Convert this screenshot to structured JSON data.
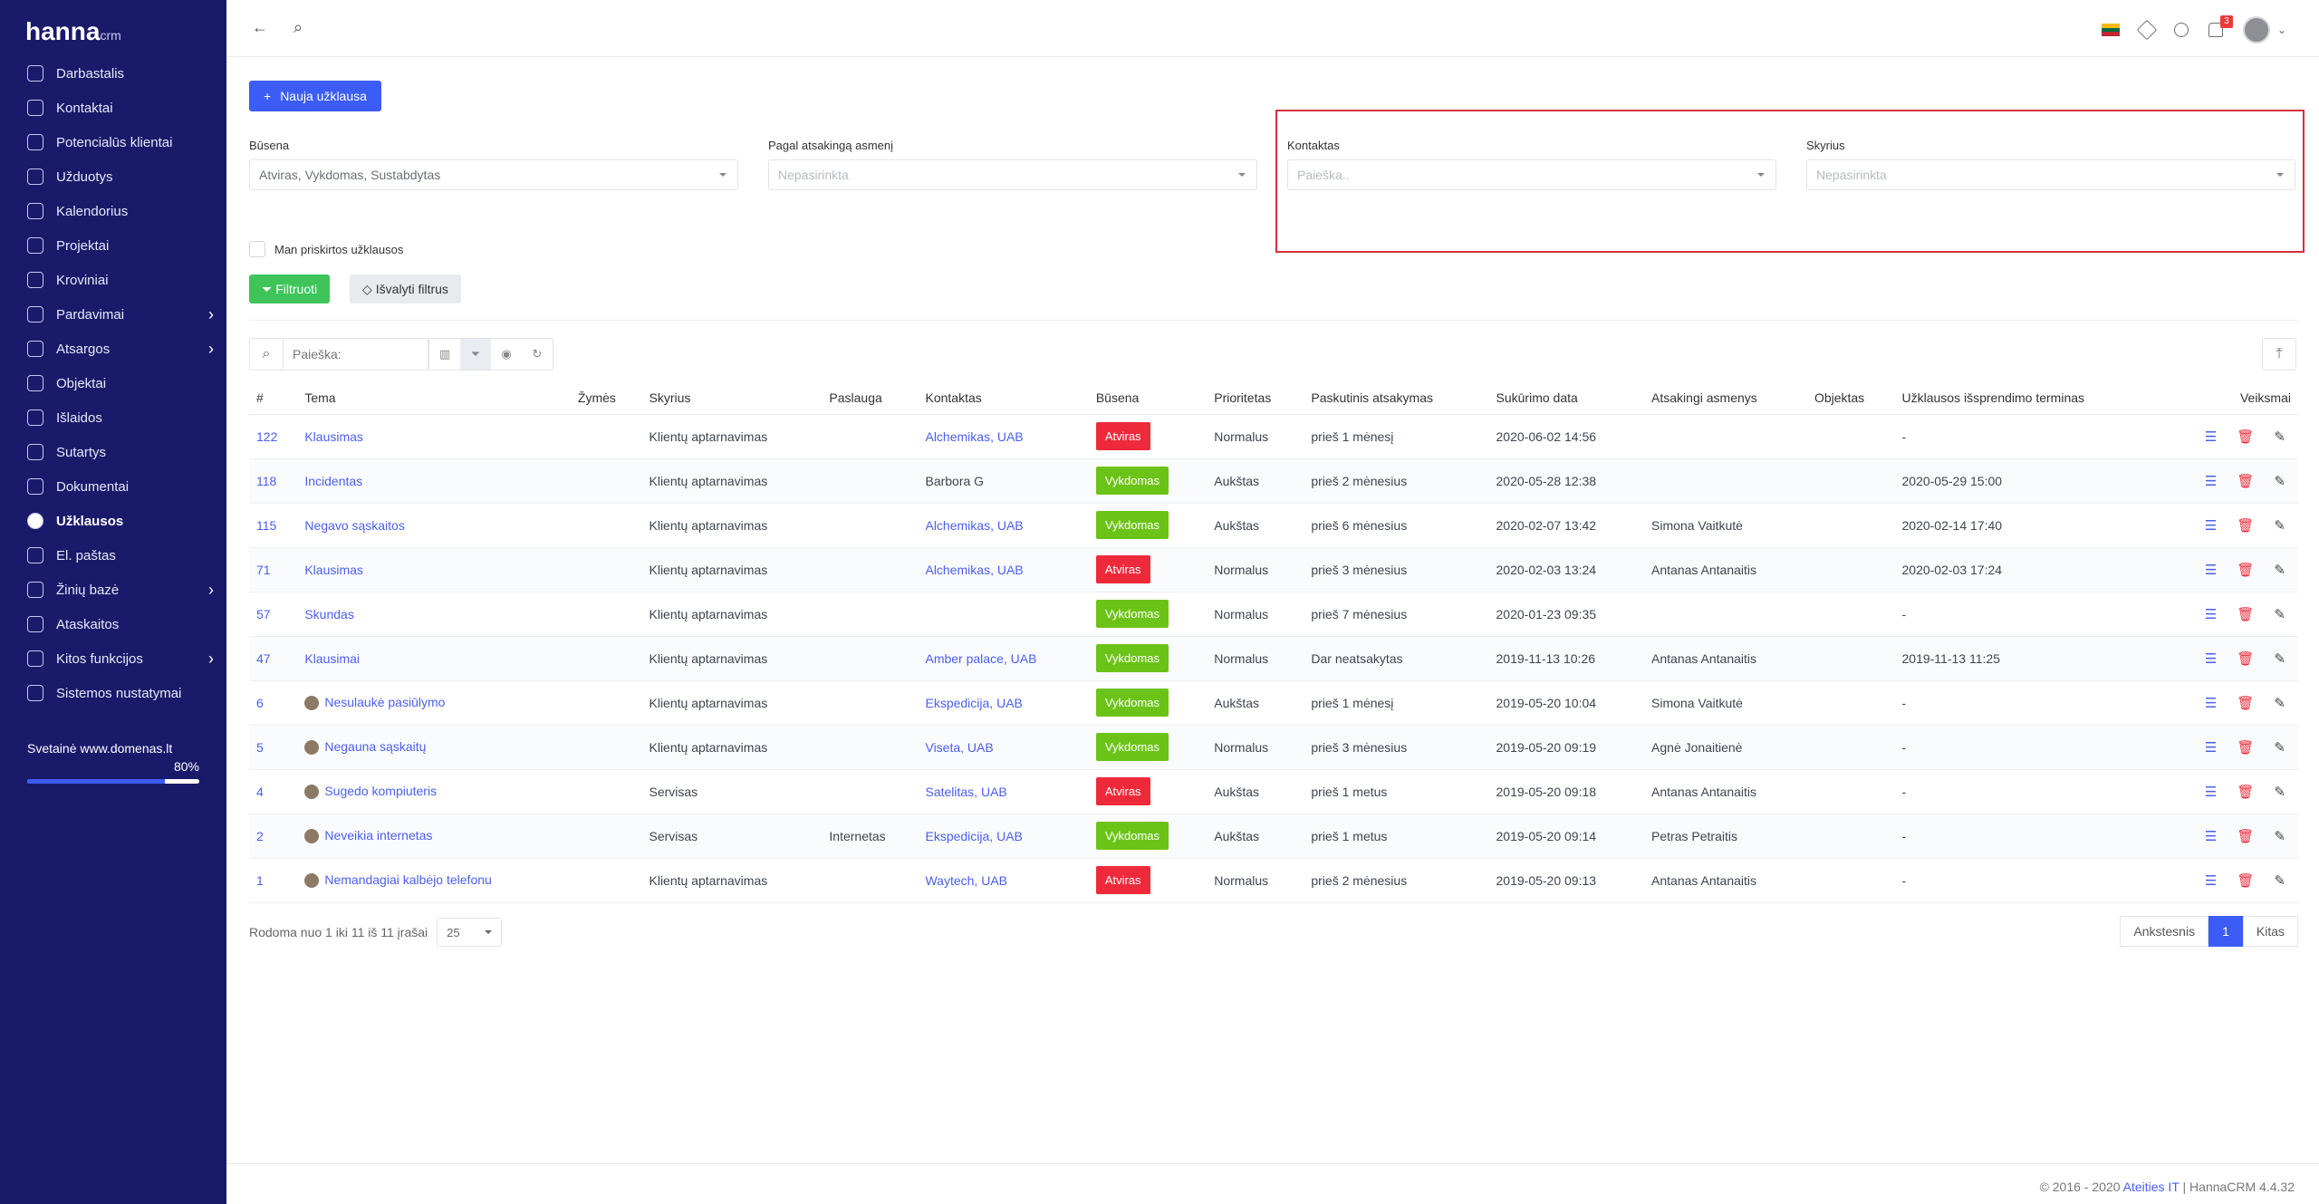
{
  "brand": {
    "name": "hanna",
    "suffix": "crm"
  },
  "sidebar": {
    "items": [
      {
        "label": "Darbastalis",
        "icon": "dashboard-icon"
      },
      {
        "label": "Kontaktai",
        "icon": "contacts-icon"
      },
      {
        "label": "Potencialūs klientai",
        "icon": "user-icon"
      },
      {
        "label": "Užduotys",
        "icon": "tasks-icon"
      },
      {
        "label": "Kalendorius",
        "icon": "calendar-icon"
      },
      {
        "label": "Projektai",
        "icon": "projects-icon"
      },
      {
        "label": "Kroviniai",
        "icon": "truck-icon"
      },
      {
        "label": "Pardavimai",
        "icon": "sales-icon",
        "submenu": true
      },
      {
        "label": "Atsargos",
        "icon": "stock-icon",
        "submenu": true
      },
      {
        "label": "Objektai",
        "icon": "building-icon"
      },
      {
        "label": "Išlaidos",
        "icon": "expenses-icon"
      },
      {
        "label": "Sutartys",
        "icon": "contract-icon"
      },
      {
        "label": "Dokumentai",
        "icon": "document-icon"
      },
      {
        "label": "Užklausos",
        "icon": "globe-icon",
        "active": true
      },
      {
        "label": "El. paštas",
        "icon": "mail-icon"
      },
      {
        "label": "Žinių bazė",
        "icon": "knowledge-icon",
        "submenu": true
      },
      {
        "label": "Ataskaitos",
        "icon": "reports-icon"
      },
      {
        "label": "Kitos funkcijos",
        "icon": "functions-icon",
        "submenu": true
      },
      {
        "label": "Sistemos nustatymai",
        "icon": "settings-icon"
      }
    ],
    "site_label": "Svetainė www.domenas.lt",
    "site_percent_text": "80%",
    "site_progress": 0.8
  },
  "topbar": {
    "notifications_count": "3"
  },
  "main": {
    "new_button": "Nauja užklausa",
    "filters": {
      "status": {
        "label": "Būsena",
        "value": "Atviras, Vykdomas, Sustabdytas"
      },
      "responsible": {
        "label": "Pagal atsakingą asmenį",
        "value": "Nepasirinkta"
      },
      "contact": {
        "label": "Kontaktas",
        "value": "Paieška.."
      },
      "department": {
        "label": "Skyrius",
        "value": "Nepasirinkta"
      },
      "mine_checkbox": "Man priskirtos užklausos",
      "filter_button": "Filtruoti",
      "clear_button": "Išvalyti filtrus"
    },
    "search_placeholder": "Paieška:",
    "columns": [
      "#",
      "Tema",
      "Žymės",
      "Skyrius",
      "Paslauga",
      "Kontaktas",
      "Būsena",
      "Prioritetas",
      "Paskutinis atsakymas",
      "Sukūrimo data",
      "Atsakingi asmenys",
      "Objektas",
      "Užklausos išsprendimo terminas",
      "Veiksmai"
    ],
    "rows": [
      {
        "id": "122",
        "topic": "Klausimas",
        "avatar": false,
        "dept": "Klientų aptarnavimas",
        "service": "",
        "contact": "Alchemikas, UAB",
        "status": "Atviras",
        "priority": "Normalus",
        "last": "prieš 1 mėnesį",
        "created": "2020-06-02 14:56",
        "resp": "",
        "object": "",
        "deadline": "-"
      },
      {
        "id": "118",
        "topic": "Incidentas",
        "avatar": false,
        "dept": "Klientų aptarnavimas",
        "service": "",
        "contact": "Barbora G",
        "contact_plain": true,
        "status": "Vykdomas",
        "priority": "Aukštas",
        "last": "prieš 2 mėnesius",
        "created": "2020-05-28 12:38",
        "resp": "",
        "object": "",
        "deadline": "2020-05-29 15:00"
      },
      {
        "id": "115",
        "topic": "Negavo sąskaitos",
        "avatar": false,
        "dept": "Klientų aptarnavimas",
        "service": "",
        "contact": "Alchemikas, UAB",
        "status": "Vykdomas",
        "priority": "Aukštas",
        "last": "prieš 6 mėnesius",
        "created": "2020-02-07 13:42",
        "resp": "Simona Vaitkutė",
        "object": "",
        "deadline": "2020-02-14 17:40"
      },
      {
        "id": "71",
        "topic": "Klausimas",
        "avatar": false,
        "dept": "Klientų aptarnavimas",
        "service": "",
        "contact": "Alchemikas, UAB",
        "status": "Atviras",
        "priority": "Normalus",
        "last": "prieš 3 mėnesius",
        "created": "2020-02-03 13:24",
        "resp": "Antanas Antanaitis",
        "object": "",
        "deadline": "2020-02-03 17:24"
      },
      {
        "id": "57",
        "topic": "Skundas",
        "avatar": false,
        "dept": "Klientų aptarnavimas",
        "service": "",
        "contact": "",
        "status": "Vykdomas",
        "priority": "Normalus",
        "last": "prieš 7 mėnesius",
        "created": "2020-01-23 09:35",
        "resp": "",
        "object": "",
        "deadline": "-"
      },
      {
        "id": "47",
        "topic": "Klausimai",
        "avatar": false,
        "dept": "Klientų aptarnavimas",
        "service": "",
        "contact": "Amber palace, UAB",
        "status": "Vykdomas",
        "priority": "Normalus",
        "last": "Dar neatsakytas",
        "created": "2019-11-13 10:26",
        "resp": "Antanas Antanaitis",
        "object": "",
        "deadline": "2019-11-13 11:25"
      },
      {
        "id": "6",
        "topic": "Nesulaukė pasiūlymo",
        "avatar": true,
        "dept": "Klientų aptarnavimas",
        "service": "",
        "contact": "Ekspedicija, UAB",
        "status": "Vykdomas",
        "priority": "Aukštas",
        "last": "prieš 1 mėnesį",
        "created": "2019-05-20 10:04",
        "resp": "Simona Vaitkutė",
        "object": "",
        "deadline": "-"
      },
      {
        "id": "5",
        "topic": "Negauna sąskaitų",
        "avatar": true,
        "dept": "Klientų aptarnavimas",
        "service": "",
        "contact": "Viseta, UAB",
        "status": "Vykdomas",
        "priority": "Normalus",
        "last": "prieš 3 mėnesius",
        "created": "2019-05-20 09:19",
        "resp": "Agnė Jonaitienė",
        "object": "",
        "deadline": "-"
      },
      {
        "id": "4",
        "topic": "Sugedo kompiuteris",
        "avatar": true,
        "dept": "Servisas",
        "service": "",
        "contact": "Satelitas, UAB",
        "status": "Atviras",
        "priority": "Aukštas",
        "last": "prieš 1 metus",
        "created": "2019-05-20 09:18",
        "resp": "Antanas Antanaitis",
        "object": "",
        "deadline": "-"
      },
      {
        "id": "2",
        "topic": "Neveikia internetas",
        "avatar": true,
        "dept": "Servisas",
        "service": "Internetas",
        "contact": "Ekspedicija, UAB",
        "status": "Vykdomas",
        "priority": "Aukštas",
        "last": "prieš 1 metus",
        "created": "2019-05-20 09:14",
        "resp": "Petras Petraitis",
        "object": "",
        "deadline": "-"
      },
      {
        "id": "1",
        "topic": "Nemandagiai kalbėjo telefonu",
        "avatar": true,
        "dept": "Klientų aptarnavimas",
        "service": "",
        "contact": "Waytech, UAB",
        "status": "Atviras",
        "priority": "Normalus",
        "last": "prieš 2 mėnesius",
        "created": "2019-05-20 09:13",
        "resp": "Antanas Antanaitis",
        "object": "",
        "deadline": "-"
      }
    ],
    "summary": "Rodoma nuo 1 iki 11 iš 11 įrašai",
    "page_size": "25",
    "pager": {
      "prev": "Ankstesnis",
      "current": "1",
      "next": "Kitas"
    }
  },
  "footer": {
    "prefix": "© 2016 - 2020 ",
    "company": "Ateities IT",
    "suffix": " | HannaCRM 4.4.32"
  },
  "colors": {
    "sidebar": "#1a1a6b",
    "accent": "#3b5cf5",
    "open": "#ee2a3a",
    "in_progress": "#6cc318"
  }
}
